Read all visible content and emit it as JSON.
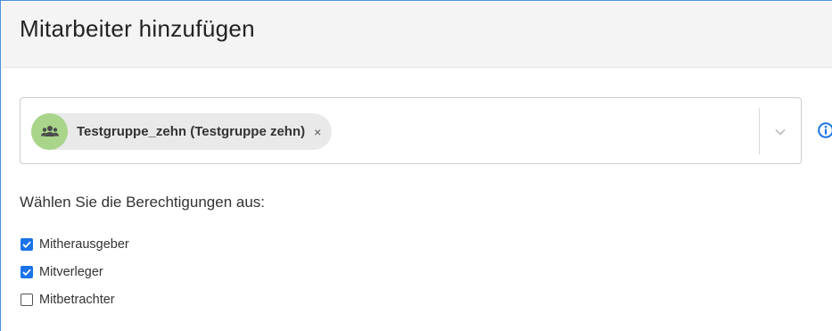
{
  "dialog": {
    "title": "Mitarbeiter hinzufügen"
  },
  "selector": {
    "chips": [
      {
        "label": "Testgruppe_zehn (Testgruppe zehn)",
        "remove": "×",
        "icon": "group-icon"
      }
    ],
    "dropdown_icon": "chevron-down-icon",
    "info_icon": "info-icon"
  },
  "permissions": {
    "label": "Wählen Sie die Berechtigungen aus:",
    "options": [
      {
        "label": "Mitherausgeber",
        "checked": true
      },
      {
        "label": "Mitverleger",
        "checked": true
      },
      {
        "label": "Mitbetrachter",
        "checked": false
      }
    ]
  },
  "colors": {
    "accent": "#1a73e8",
    "avatar": "#a8d58a",
    "chip": "#e9e9e9",
    "header": "#f4f4f4"
  }
}
